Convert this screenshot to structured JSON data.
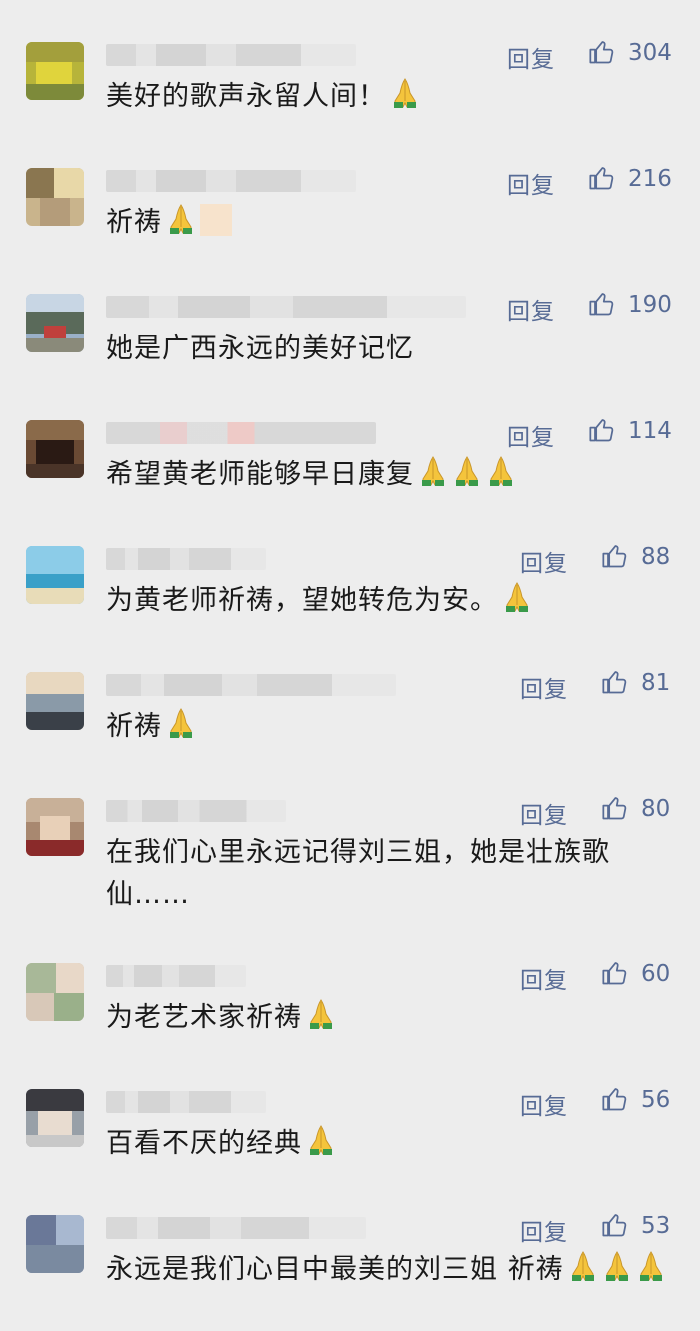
{
  "reply_label": "回复",
  "accent": "#576b95",
  "comments": [
    {
      "text": "美好的歌声永留人间！",
      "likes": "304",
      "emojis": 1
    },
    {
      "text": "祈祷",
      "likes": "216",
      "emojis": 1,
      "blurred_emoji": true
    },
    {
      "text": "她是广西永远的美好记忆",
      "likes": "190",
      "emojis": 0
    },
    {
      "text": "希望黄老师能够早日康复",
      "likes": "114",
      "emojis": 3
    },
    {
      "text": "为黄老师祈祷，望她转危为安。",
      "likes": "88",
      "emojis": 1
    },
    {
      "text": "祈祷",
      "likes": "81",
      "emojis": 1
    },
    {
      "text": "在我们心里永远记得刘三姐，她是壮族歌仙……",
      "likes": "80",
      "emojis": 0
    },
    {
      "text": "为老艺术家祈祷",
      "likes": "60",
      "emojis": 1
    },
    {
      "text": "百看不厌的经典",
      "likes": "56",
      "emojis": 1
    },
    {
      "text": "永远是我们心目中最美的刘三姐 祈祷",
      "likes": "53",
      "emojis": 3
    }
  ]
}
